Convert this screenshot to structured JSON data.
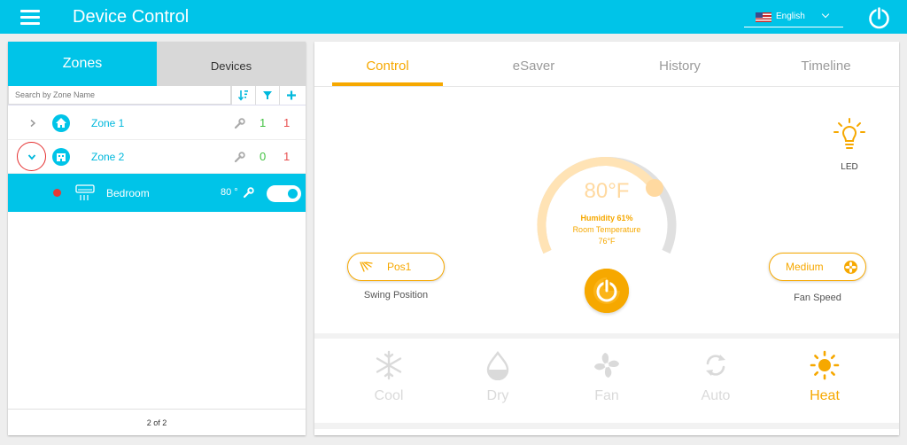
{
  "header": {
    "title": "Device Control",
    "language": "English"
  },
  "zones_panel": {
    "tabs": {
      "zones": "Zones",
      "devices": "Devices"
    },
    "search_placeholder": "Search by Zone Name",
    "zones": [
      {
        "name": "Zone 1",
        "count_green": "1",
        "count_red": "1",
        "expanded": false
      },
      {
        "name": "Zone 2",
        "count_green": "0",
        "count_red": "1",
        "expanded": true
      }
    ],
    "device": {
      "name": "Bedroom",
      "temp": "80 °",
      "on": true
    },
    "pager": "2 of 2"
  },
  "control": {
    "tabs": [
      "Control",
      "eSaver",
      "History",
      "Timeline"
    ],
    "active_tab": "Control",
    "led_label": "LED",
    "setpoint": "80°F",
    "humidity": "Humidity 61%",
    "room_temp_label": "Room Temperature",
    "room_temp": "76°F",
    "swing": {
      "value": "Pos1",
      "caption": "Swing Position"
    },
    "fan": {
      "value": "Medium",
      "caption": "Fan Speed"
    },
    "modes": [
      {
        "label": "Cool",
        "icon": "snowflake-icon",
        "active": false
      },
      {
        "label": "Dry",
        "icon": "water-drop-icon",
        "active": false
      },
      {
        "label": "Fan",
        "icon": "fan-icon",
        "active": false
      },
      {
        "label": "Auto",
        "icon": "auto-cycle-icon",
        "active": false
      },
      {
        "label": "Heat",
        "icon": "sun-icon",
        "active": true
      }
    ]
  },
  "colors": {
    "primary": "#00c4e8",
    "accent": "#f6a800",
    "alert": "#e53935",
    "ok": "#43c243"
  }
}
